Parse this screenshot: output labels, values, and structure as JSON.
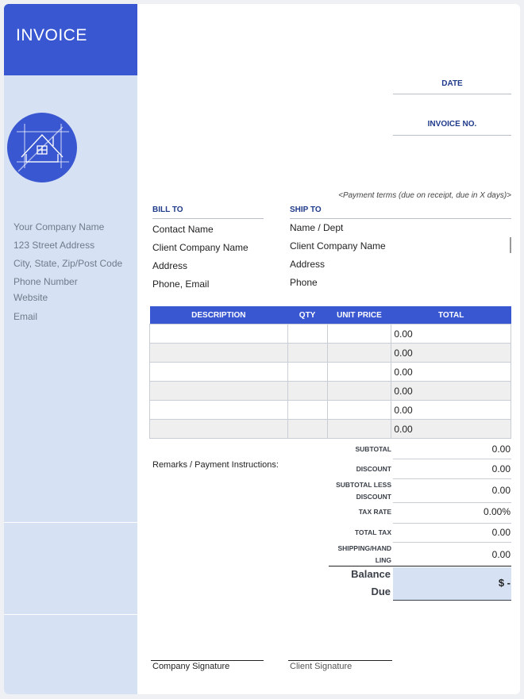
{
  "colors": {
    "accent": "#3957d1",
    "sidebar": "#d6e2f4",
    "label": "#1f3a8a"
  },
  "header": {
    "title": "INVOICE",
    "logo_icon": "house-blueprint-icon"
  },
  "company": {
    "name": "Your Company Name",
    "street": "123 Street Address",
    "city": "City, State, Zip/Post Code",
    "phone": "Phone Number",
    "website": "Website",
    "email": "Email"
  },
  "meta": {
    "date_label": "DATE",
    "invoice_no_label": "INVOICE NO.",
    "payment_terms": "<Payment terms (due on receipt, due in X days)>"
  },
  "bill_to": {
    "heading": "BILL TO",
    "lines": [
      "Contact Name",
      "Client Company Name",
      "Address",
      "Phone, Email"
    ]
  },
  "ship_to": {
    "heading": "SHIP TO",
    "lines": [
      "Name / Dept",
      "Client Company Name",
      "Address",
      "Phone"
    ]
  },
  "items": {
    "headers": [
      "DESCRIPTION",
      "QTY",
      "UNIT PRICE",
      "TOTAL"
    ],
    "rows": [
      {
        "total": "0.00"
      },
      {
        "total": "0.00"
      },
      {
        "total": "0.00"
      },
      {
        "total": "0.00"
      },
      {
        "total": "0.00"
      },
      {
        "total": "0.00"
      }
    ]
  },
  "remarks_label": "Remarks / Payment Instructions:",
  "summary": {
    "subtotal_label": "SUBTOTAL",
    "subtotal": "0.00",
    "discount_label": "DISCOUNT",
    "discount": "0.00",
    "subtotal_less_1": "SUBTOTAL LESS",
    "subtotal_less_2": "DISCOUNT",
    "subtotal_less": "0.00",
    "tax_rate_label": "TAX RATE",
    "tax_rate": "0.00%",
    "total_tax_label": "TOTAL TAX",
    "total_tax": "0.00",
    "shipping_1": "SHIPPING/HAND",
    "shipping_2": "LING",
    "shipping": "0.00",
    "balance_1": "Balance",
    "balance_2": "Due",
    "balance": "$ -"
  },
  "signatures": {
    "company": "Company Signature",
    "client": "Client Signature"
  }
}
